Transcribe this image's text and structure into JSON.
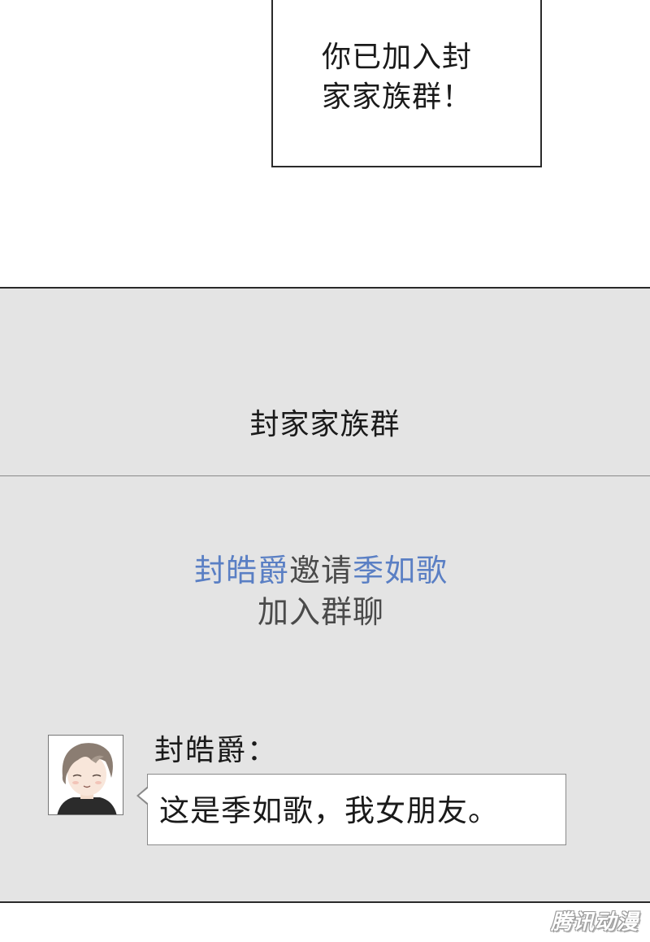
{
  "narration": {
    "lines": [
      "你已加入封",
      "家家族群！"
    ]
  },
  "chat": {
    "group_title": "封家家族群",
    "system_message": {
      "inviter": "封皓爵",
      "verb": "邀请",
      "invitee": "季如歌",
      "suffix": "加入群聊"
    },
    "message": {
      "sender": "封皓爵：",
      "text": "这是季如歌，我女朋友。",
      "avatar": "smiling-boy-avatar"
    }
  },
  "watermark": "腾讯动漫",
  "colors": {
    "panel_bg": "#e4e4e4",
    "name_highlight": "#5a7fc4",
    "system_text": "#4a4a4a"
  }
}
